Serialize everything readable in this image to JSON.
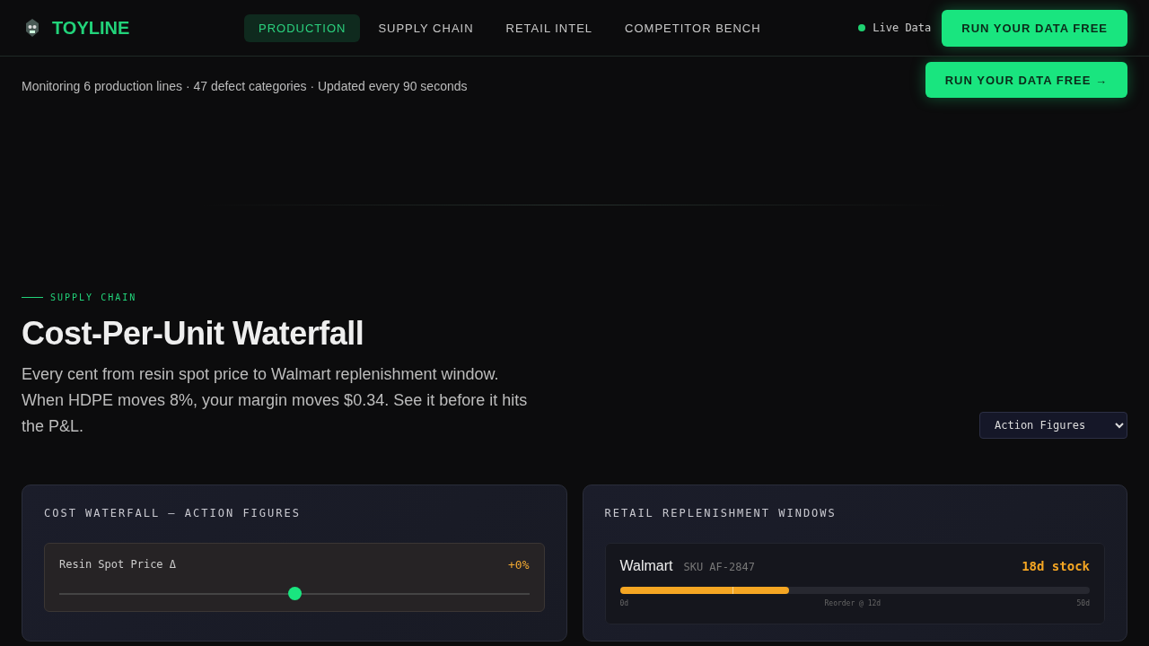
{
  "header": {
    "brand": "TOYLINE",
    "nav": [
      {
        "label": "PRODUCTION",
        "selected": true
      },
      {
        "label": "SUPPLY CHAIN",
        "selected": false
      },
      {
        "label": "RETAIL INTEL",
        "selected": false
      },
      {
        "label": "COMPETITOR BENCH",
        "selected": false
      }
    ],
    "live": "Live Data",
    "cta": "RUN YOUR DATA FREE"
  },
  "subheader": {
    "text": "Monitoring 6 production lines · 47 defect categories · Updated every 90 seconds",
    "cta": "RUN YOUR DATA FREE →"
  },
  "section": {
    "eyebrow": "SUPPLY CHAIN",
    "title": "Cost-Per-Unit Waterfall",
    "description": "Every cent from resin spot price to Walmart replenishment window. When HDPE moves 8%, your margin moves $0.34. See it before it hits the P&L.",
    "category": {
      "value": "Action Figures"
    }
  },
  "cost_card": {
    "title": "COST WATERFALL — ACTION FIGURES",
    "slider": {
      "label": "Resin Spot Price Δ",
      "reading": "+0%",
      "level": 0.5
    }
  },
  "retail_card": {
    "title": "RETAIL REPLENISHMENT WINDOWS",
    "retailers": [
      {
        "name": "Walmart",
        "sku": "SKU AF-2847",
        "stock": "18d stock",
        "level": 0.36,
        "min": "0d",
        "reorder": "Reorder @ 12d",
        "max": "50d"
      }
    ]
  }
}
